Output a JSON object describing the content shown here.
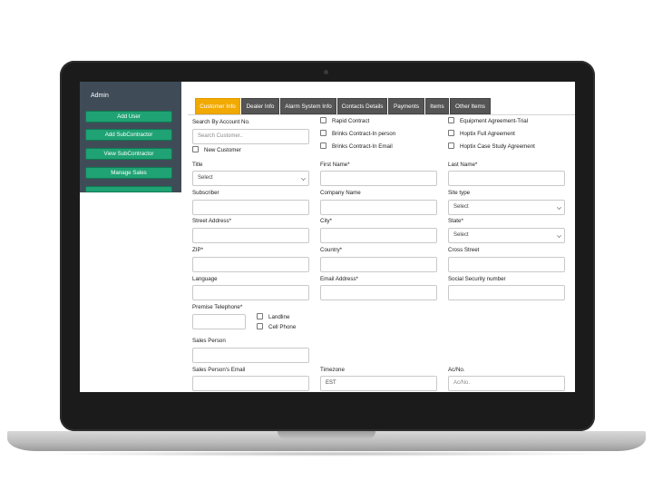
{
  "sidebar": {
    "title": "Admin",
    "buttons": [
      "Add User",
      "Add SubContractor",
      "View SubContractor",
      "Manage Sales"
    ]
  },
  "tabs": [
    "Customer Info",
    "Dealer Info",
    "Alarm System Info",
    "Contacts Details",
    "Payments",
    "Items",
    "Other Items"
  ],
  "form": {
    "search_by_account_label": "Search By Account No.",
    "search_customer_placeholder": "Search Customer..",
    "new_customer_label": "New Customer",
    "rapid_contract_label": "Rapid Contract",
    "brinks_in_person_label": "Brinks Contract-In person",
    "brinks_in_email_label": "Brinks Contract-In Email",
    "equipment_agreement_label": "Equipment Agreement-Trial",
    "hoptix_full_label": "Hoptix Full Agreement",
    "hoptix_case_label": "Hoptix Case Study Agreement",
    "title_label": "Title",
    "title_value": "Select",
    "first_name_label": "First Name*",
    "last_name_label": "Last Name*",
    "subscriber_label": "Subscriber",
    "company_name_label": "Company Name",
    "site_type_label": "Site type",
    "site_type_value": "Select",
    "street_address_label": "Street Address*",
    "city_label": "City*",
    "state_label": "State*",
    "state_value": "Select",
    "zip_label": "ZIP*",
    "country_label": "Country*",
    "cross_street_label": "Cross Street",
    "language_label": "Language",
    "email_label": "Email Address*",
    "ssn_label": "Social Security number",
    "premise_phone_label": "Premise Telephone*",
    "landline_label": "Landline",
    "cell_phone_label": "Cell Phone",
    "sales_person_label": "Sales Person",
    "sales_email_label": "Sales Person's Email",
    "timezone_label": "Timezone",
    "timezone_value": "EST",
    "acno_label": "Ac/No.",
    "acno_placeholder": "Ac/No."
  },
  "colors": {
    "sidebar_bg": "#3f4c57",
    "sidebar_button": "#1fa274",
    "tab_bg": "#555555",
    "tab_active": "#f2a900"
  }
}
